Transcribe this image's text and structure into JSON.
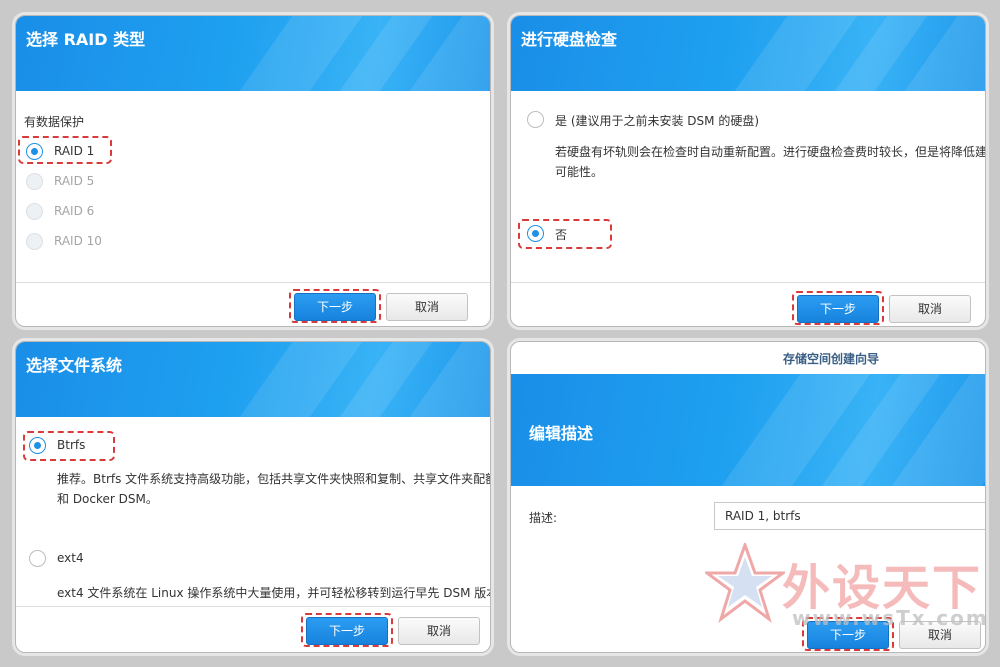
{
  "panel1": {
    "title": "选择 RAID 类型",
    "section_label": "有数据保护",
    "options": [
      {
        "label": "RAID 1",
        "checked": true,
        "disabled": false
      },
      {
        "label": "RAID 5",
        "checked": false,
        "disabled": true
      },
      {
        "label": "RAID 6",
        "checked": false,
        "disabled": true
      },
      {
        "label": "RAID 10",
        "checked": false,
        "disabled": true
      }
    ],
    "next_label": "下一步",
    "cancel_label": "取消"
  },
  "panel2": {
    "title": "进行硬盘检查",
    "option_yes_label": "是 (建议用于之前未安装 DSM 的硬盘)",
    "option_yes_desc_line1": "若硬盘有坏轨则会在检查时自动重新配置。进行硬盘检查费时较长，但是将降低建",
    "option_yes_desc_line2": "可能性。",
    "option_no_label": "否",
    "next_label": "下一步",
    "cancel_label": "取消"
  },
  "panel3": {
    "title": "选择文件系统",
    "option_btrfs_label": "Btrfs",
    "btrfs_desc_line1": "推荐。Btrfs 文件系统支持高级功能，包括共享文件夹快照和复制、共享文件夹配额",
    "btrfs_desc_line2": "和 Docker DSM。",
    "option_ext4_label": "ext4",
    "ext4_desc_line1": "ext4 文件系统在 Linux 操作系统中大量使用，并可轻松移转到运行早先 DSM 版本",
    "next_label": "下一步",
    "cancel_label": "取消"
  },
  "panel4": {
    "window_title": "存储空间创建向导",
    "title": "编辑描述",
    "desc_label": "描述:",
    "desc_value": "RAID 1, btrfs",
    "next_label": "下一步",
    "cancel_label": "取消"
  },
  "watermark": {
    "text": "外设天下",
    "url": "www.wsTx.com"
  },
  "colors": {
    "banner_blue": "#1a8ee8",
    "primary_button": "#1783dd",
    "highlight_dash": "#d93a3a"
  }
}
